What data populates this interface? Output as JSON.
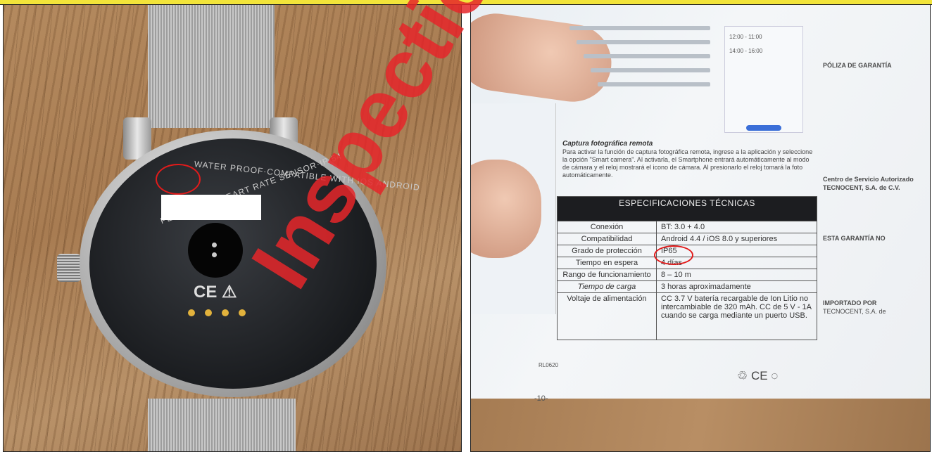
{
  "watch": {
    "case_text_left": "PEDOMETER·HEART RATE SENSOR·IP 54",
    "case_text_top": "WATER PROOF·COMPATIBLE WITH IOS ANDROID"
  },
  "manual": {
    "capture_heading": "Captura fotográfica remota",
    "capture_text": "Para activar la función de captura fotográfica remota, ingrese a la aplicación y seleccione la opción \"Smart camera\". Al activarla, el Smartphone entrará automáticamente al modo de cámara y el reloj mostrará el icono de cámara. Al presionarlo el reloj tomará la foto automáticamente.",
    "specs_title": "ESPECIFICACIONES TÉCNICAS",
    "specs": [
      {
        "label": "Conexión",
        "value": "BT: 3.0 + 4.0"
      },
      {
        "label": "Compatibilidad",
        "value": "Android 4.4 / iOS 8.0 y superiores"
      },
      {
        "label": "Grado de protección",
        "value": "IP65"
      },
      {
        "label": "Tiempo en espera",
        "value": "4 días"
      },
      {
        "label": "Rango de funcionamiento",
        "value": "8 – 10 m"
      },
      {
        "label": "Tiempo de carga",
        "value": "3 horas aproximadamente"
      },
      {
        "label": "Voltaje de alimentación",
        "value": "CC 3.7 V batería recargable de Ion Litio no intercambiable de 320 mAh. CC de 5 V - 1A cuando se carga mediante un puerto USB."
      }
    ],
    "code": "RL0620",
    "page_number": "-10-",
    "warranty_heading": "PÓLIZA DE GARANTÍA",
    "service_center": "Centro de Servicio Autorizado",
    "company": "TECNOCENT, S.A. de C.V.",
    "exclusions_heading": "ESTA GARANTÍA NO",
    "importer_heading": "IMPORTADO POR",
    "importer_company": "TECNOCENT, S.A. de",
    "time_1": "12:00 - 11:00",
    "time_2": "14:00 - 16:00"
  },
  "watermark": "Inspection - CC",
  "colors": {
    "highlight": "#e21b1b",
    "watermark": "#e6262a",
    "header_bar": "#f2e43a"
  }
}
